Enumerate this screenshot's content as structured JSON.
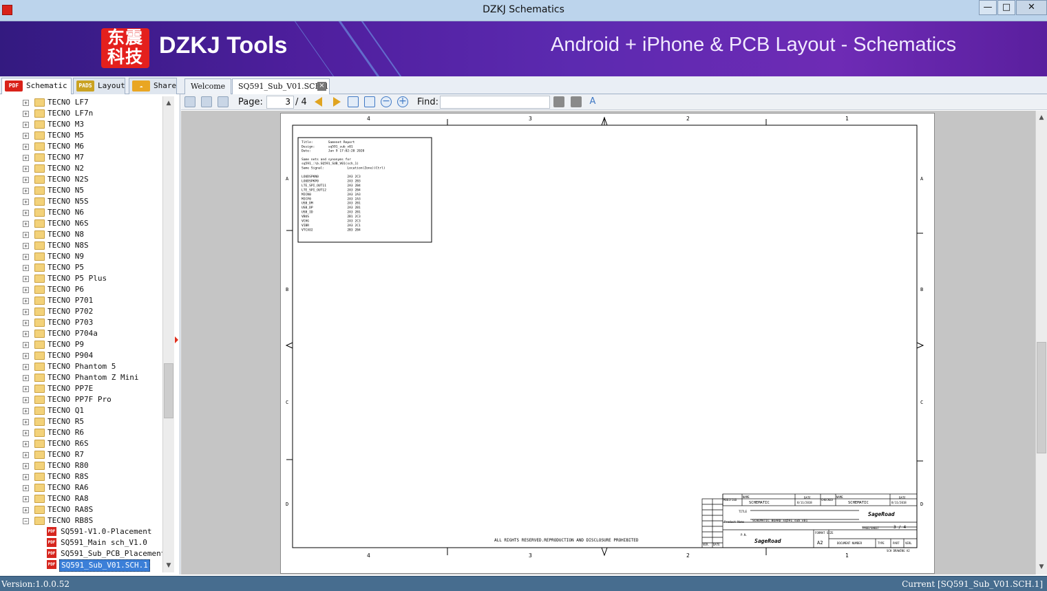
{
  "window": {
    "title": "DZKJ Schematics",
    "controls": {
      "minimize": "—",
      "maximize": "□",
      "close": "✕"
    }
  },
  "banner": {
    "logo_text": "东震科技",
    "brand": "DZKJ Tools",
    "tagline": "Android + iPhone & PCB Layout - Schematics",
    "colors": {
      "background": "#4f1f9e",
      "logo": "#e4201d"
    }
  },
  "left_tabs": [
    {
      "label": "Schematic",
      "icon": "PDF",
      "icon_color": "#d9221a"
    },
    {
      "label": "Layout",
      "icon": "PADS",
      "icon_color": "#caa222"
    },
    {
      "label": "Share",
      "icon": "share-icon",
      "icon_color": "#e9a623"
    }
  ],
  "doc_tabs": [
    {
      "label": "Welcome"
    },
    {
      "label": "SQ591_Sub_V01.SCH.1",
      "close": "×"
    }
  ],
  "tree": {
    "folders": [
      "TECNO LF7",
      "TECNO LF7n",
      "TECNO M3",
      "TECNO M5",
      "TECNO M6",
      "TECNO M7",
      "TECNO N2",
      "TECNO N2S",
      "TECNO N5",
      "TECNO N5S",
      "TECNO N6",
      "TECNO N6S",
      "TECNO N8",
      "TECNO N8S",
      "TECNO N9",
      "TECNO P5",
      "TECNO P5 Plus",
      "TECNO P6",
      "TECNO P701",
      "TECNO P702",
      "TECNO P703",
      "TECNO P704a",
      "TECNO P9",
      "TECNO P904",
      "TECNO Phantom 5",
      "TECNO Phantom Z Mini",
      "TECNO PP7E",
      "TECNO PP7F Pro",
      "TECNO Q1",
      "TECNO R5",
      "TECNO R6",
      "TECNO R6S",
      "TECNO R7",
      "TECNO R80",
      "TECNO R8S",
      "TECNO RA6",
      "TECNO RA8",
      "TECNO RA8S",
      "TECNO RB8S"
    ],
    "files": [
      "SQ591-V1.0-Placement",
      "SQ591_Main sch_V1.0",
      "SQ591_Sub_PCB_Placement",
      "SQ591_Sub_V01.SCH.1"
    ],
    "selected_file": "SQ591_Sub_V01.SCH.1"
  },
  "toolbar": {
    "page_label": "Page:",
    "page_current": "3",
    "page_total": "/ 4",
    "find_label": "Find:",
    "find_value": ""
  },
  "schematic": {
    "col_labels_top": [
      "4",
      "3",
      "2",
      "1"
    ],
    "col_labels_bottom": [
      "4",
      "3",
      "2",
      "1"
    ],
    "row_labels": [
      "A",
      "B",
      "C",
      "D"
    ],
    "report": {
      "header": [
        "Title:        Samenet Report",
        "Design:       sq591_sub_v01",
        "Date:         Jan 9 17:02:20 2020"
      ],
      "intro": [
        "Same nets and synonyms for",
        "sq591_:\\b.SQ591_SUB_V01(sch_1)"
      ],
      "columns": "Same Signal:            Location(Zone)(Ctrl)",
      "rows": [
        "LOUDSPKN0               2A3 2C3",
        "LOUDSPKP0               2A3 2B3",
        "LTE_SPI_OUT11           2A3 2B4",
        "LTE_SPI_OUT12           2A3 2B4",
        "MICN0                   2A3 2A3",
        "MICP0                   2A3 2A3",
        "USB_DM                  2A3 2B1",
        "USB_DP                  2A3 2B1",
        "USB_ID                  2A3 2B1",
        "VBUS                    2B1 2C3",
        "VCHG                    2A3 2C3",
        "VIBR                    2A3 2C1",
        "VTCXO2                  2B3 2B4"
      ]
    },
    "rights": "ALL RIGHTS RESERVED.REPRODUCTION AND DISCLOSURE PROHIBITED",
    "title_block": {
      "modified": "MODIFIED",
      "name_label": "NAME",
      "name_value": "SCHEMATIC",
      "date_label": "DATE",
      "date_value": "8/11/2018",
      "checked": "CHECKED",
      "checked_name": "SCHEMATIC",
      "checked_date": "8/11/2018",
      "title_label": "TITLE",
      "product_label": "Product Name",
      "product_value": "SCHEMATIC BOARD sq591_sub_v01",
      "page_sheet_label": "PAGE/SHEET",
      "page_sheet_value": "3 / 4",
      "pn_label": "P.N.",
      "format_label": "FORMAT SIZE",
      "format_value": "A2",
      "doc_number": "DOCUMENT NUMBER",
      "type": "TYPE",
      "part": "PART",
      "verl": "VERL",
      "ver": "VER.",
      "date_small": "DATE",
      "sch_drawing": "SCH DRAWING A2",
      "logo": "SageRoad"
    }
  },
  "status": {
    "version": "Version:1.0.0.52",
    "current": "Current [SQ591_Sub_V01.SCH.1]"
  }
}
